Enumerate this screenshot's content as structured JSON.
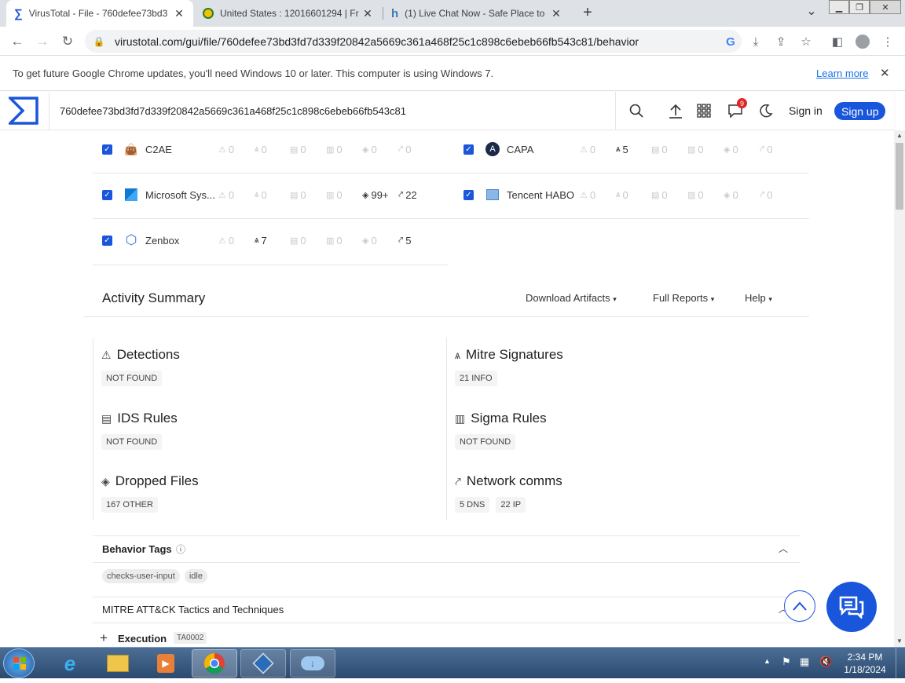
{
  "browser": {
    "tabs": [
      {
        "title": "VirusTotal - File - 760defee73bd3",
        "close": "✕"
      },
      {
        "title": "United States : 12016601294 | Fr",
        "close": "✕"
      },
      {
        "title": "(1) Live Chat Now - Safe Place to",
        "close": "✕"
      }
    ],
    "new_tab": "+",
    "tab_menu": "⌄",
    "url": "virustotal.com/gui/file/760defee73bd3fd7d339f20842a5669c361a468f25c1c898c6ebeb66fb543c81/behavior",
    "infobar_text": "To get future Google Chrome updates, you'll need Windows 10 or later. This computer is using Windows 7.",
    "infobar_link": "Learn more",
    "infobar_close": "✕"
  },
  "vt": {
    "search_value": "760defee73bd3fd7d339f20842a5669c361a468f25c1c898c6ebeb66fb543c81",
    "notification_count": "9",
    "sign_in": "Sign in",
    "sign_up": "Sign up"
  },
  "sandboxes": [
    {
      "name": "C2AE",
      "icon": "bag-icon",
      "stats": [
        "0",
        "0",
        "0",
        "0",
        "0",
        "0"
      ]
    },
    {
      "name": "CAPA",
      "icon": "capa-icon",
      "stats": [
        "0",
        "5",
        "0",
        "0",
        "0",
        "0"
      ]
    },
    {
      "name": "Microsoft Sys...",
      "icon": "microsoft-icon",
      "stats": [
        "0",
        "0",
        "0",
        "0",
        "99+",
        "22"
      ]
    },
    {
      "name": "Tencent HABO",
      "icon": "tencent-icon",
      "stats": [
        "0",
        "0",
        "0",
        "0",
        "0",
        "0"
      ]
    },
    {
      "name": "Zenbox",
      "icon": "cube-icon",
      "stats": [
        "0",
        "7",
        "0",
        "0",
        "0",
        "5"
      ]
    }
  ],
  "activity": {
    "title": "Activity Summary",
    "menus": [
      "Download Artifacts",
      "Full Reports",
      "Help"
    ],
    "blocks": [
      {
        "title": "Detections",
        "pills": [
          "NOT FOUND"
        ]
      },
      {
        "title": "Mitre Signatures",
        "pills": [
          "21 INFO"
        ]
      },
      {
        "title": "IDS Rules",
        "pills": [
          "NOT FOUND"
        ]
      },
      {
        "title": "Sigma Rules",
        "pills": [
          "NOT FOUND"
        ]
      },
      {
        "title": "Dropped Files",
        "pills": [
          "167 OTHER"
        ]
      },
      {
        "title": "Network comms",
        "pills": [
          "5 DNS",
          "22 IP"
        ]
      }
    ]
  },
  "behavior_tags": {
    "title": "Behavior Tags",
    "tags": [
      "checks-user-input",
      "idle"
    ]
  },
  "mitre": {
    "title": "MITRE ATT&CK Tactics and Techniques",
    "first": "Execution",
    "first_id": "TA0002"
  },
  "taskbar": {
    "time": "2:34 PM",
    "date": "1/18/2024"
  },
  "colors": {
    "accent": "#1a56db",
    "badge": "#e02424"
  }
}
